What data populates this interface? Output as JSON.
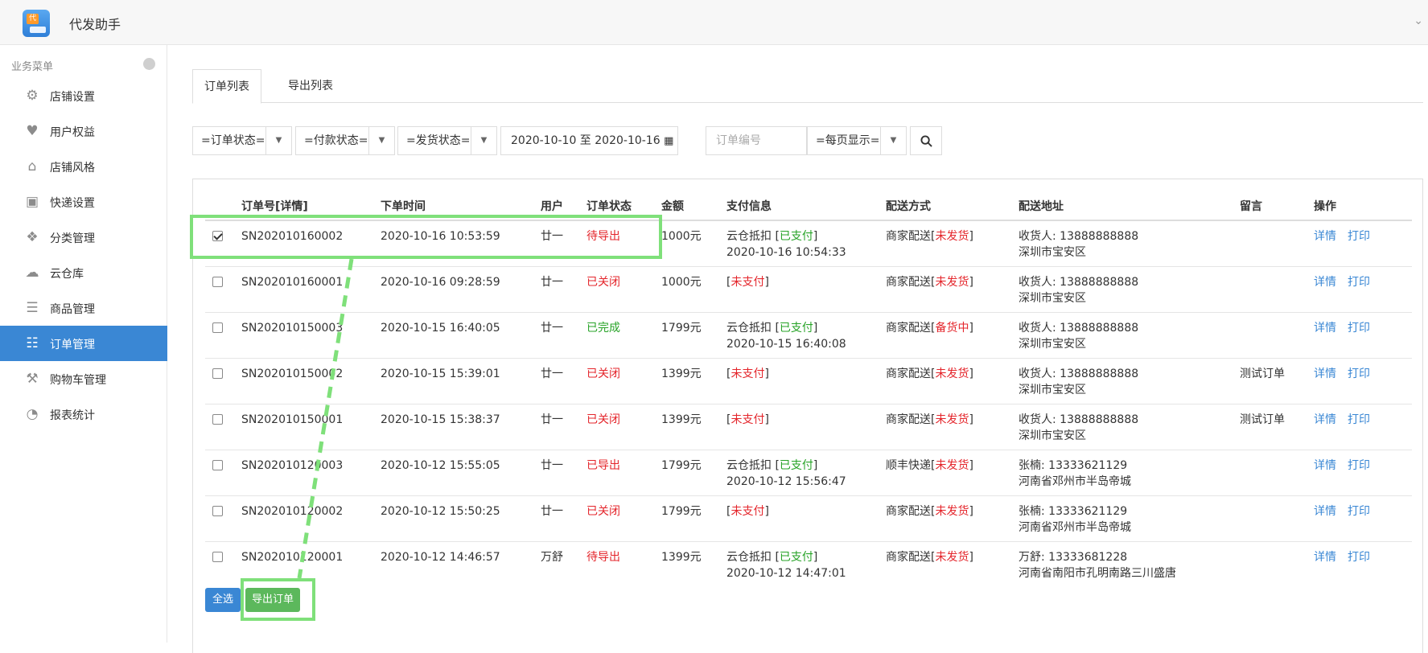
{
  "app": {
    "title": "代发助手",
    "logo_tag": "代"
  },
  "sidebar": {
    "header": "业务菜单",
    "items": [
      {
        "label": "店铺设置",
        "icon": "gear-icon"
      },
      {
        "label": "用户权益",
        "icon": "heart-icon"
      },
      {
        "label": "店铺风格",
        "icon": "home-icon"
      },
      {
        "label": "快递设置",
        "icon": "bag-icon"
      },
      {
        "label": "分类管理",
        "icon": "grid-icon"
      },
      {
        "label": "云仓库",
        "icon": "cloud-icon"
      },
      {
        "label": "商品管理",
        "icon": "list-icon"
      },
      {
        "label": "订单管理",
        "icon": "receipt-icon"
      },
      {
        "label": "购物车管理",
        "icon": "cart-icon"
      },
      {
        "label": "报表统计",
        "icon": "pie-chart-icon"
      }
    ],
    "active_index": 7
  },
  "tabs": [
    {
      "label": "订单列表"
    },
    {
      "label": "导出列表"
    }
  ],
  "filters": {
    "order_status": "=订单状态=",
    "pay_status": "=付款状态=",
    "ship_status": "=发货状态=",
    "date_range": "2020-10-10 至 2020-10-16",
    "order_no_placeholder": "订单编号",
    "per_page": "=每页显示="
  },
  "table": {
    "headers": [
      "订单号[详情]",
      "下单时间",
      "用户",
      "订单状态",
      "金额",
      "支付信息",
      "配送方式",
      "配送地址",
      "留言",
      "操作"
    ],
    "rows": [
      {
        "checked": true,
        "order_no": "SN202010160002",
        "time": "2020-10-16 10:53:59",
        "user": "廿一",
        "status": "待导出",
        "status_color": "red",
        "amount": "1000元",
        "pay_main": "云仓抵扣 [",
        "pay_tag": "已支付",
        "pay_tag_color": "green",
        "pay_end": "]",
        "pay_time": "2020-10-16 10:54:33",
        "ship_main": "商家配送[",
        "ship_tag": "未发货",
        "ship_end": "]",
        "addr1": "收货人: 13888888888",
        "addr2": "深圳市宝安区",
        "note": ""
      },
      {
        "checked": false,
        "order_no": "SN202010160001",
        "time": "2020-10-16 09:28:59",
        "user": "廿一",
        "status": "已关闭",
        "status_color": "red",
        "amount": "1000元",
        "pay_main": "[",
        "pay_tag": "未支付",
        "pay_tag_color": "red",
        "pay_end": "]",
        "pay_time": "",
        "ship_main": "商家配送[",
        "ship_tag": "未发货",
        "ship_end": "]",
        "addr1": "收货人: 13888888888",
        "addr2": "深圳市宝安区",
        "note": ""
      },
      {
        "checked": false,
        "order_no": "SN202010150003",
        "time": "2020-10-15 16:40:05",
        "user": "廿一",
        "status": "已完成",
        "status_color": "green",
        "amount": "1799元",
        "pay_main": "云仓抵扣 [",
        "pay_tag": "已支付",
        "pay_tag_color": "green",
        "pay_end": "]",
        "pay_time": "2020-10-15 16:40:08",
        "ship_main": "商家配送[",
        "ship_tag": "备货中",
        "ship_end": "]",
        "addr1": "收货人: 13888888888",
        "addr2": "深圳市宝安区",
        "note": ""
      },
      {
        "checked": false,
        "order_no": "SN202010150002",
        "time": "2020-10-15 15:39:01",
        "user": "廿一",
        "status": "已关闭",
        "status_color": "red",
        "amount": "1399元",
        "pay_main": "[",
        "pay_tag": "未支付",
        "pay_tag_color": "red",
        "pay_end": "]",
        "pay_time": "",
        "ship_main": "商家配送[",
        "ship_tag": "未发货",
        "ship_end": "]",
        "addr1": "收货人: 13888888888",
        "addr2": "深圳市宝安区",
        "note": "测试订单"
      },
      {
        "checked": false,
        "order_no": "SN202010150001",
        "time": "2020-10-15 15:38:37",
        "user": "廿一",
        "status": "已关闭",
        "status_color": "red",
        "amount": "1399元",
        "pay_main": "[",
        "pay_tag": "未支付",
        "pay_tag_color": "red",
        "pay_end": "]",
        "pay_time": "",
        "ship_main": "商家配送[",
        "ship_tag": "未发货",
        "ship_end": "]",
        "addr1": "收货人: 13888888888",
        "addr2": "深圳市宝安区",
        "note": "测试订单"
      },
      {
        "checked": false,
        "order_no": "SN202010120003",
        "time": "2020-10-12 15:55:05",
        "user": "廿一",
        "status": "已导出",
        "status_color": "red",
        "amount": "1799元",
        "pay_main": "云仓抵扣 [",
        "pay_tag": "已支付",
        "pay_tag_color": "green",
        "pay_end": "]",
        "pay_time": "2020-10-12 15:56:47",
        "ship_main": "顺丰快递[",
        "ship_tag": "未发货",
        "ship_end": "]",
        "addr1": "张楠: 13333621129",
        "addr2": "河南省邓州市半岛帝城",
        "note": ""
      },
      {
        "checked": false,
        "order_no": "SN202010120002",
        "time": "2020-10-12 15:50:25",
        "user": "廿一",
        "status": "已关闭",
        "status_color": "red",
        "amount": "1799元",
        "pay_main": "[",
        "pay_tag": "未支付",
        "pay_tag_color": "red",
        "pay_end": "]",
        "pay_time": "",
        "ship_main": "商家配送[",
        "ship_tag": "未发货",
        "ship_end": "]",
        "addr1": "张楠: 13333621129",
        "addr2": "河南省邓州市半岛帝城",
        "note": ""
      },
      {
        "checked": false,
        "order_no": "SN202010120001",
        "time": "2020-10-12 14:46:57",
        "user": "万舒",
        "status": "待导出",
        "status_color": "red",
        "amount": "1399元",
        "pay_main": "云仓抵扣 [",
        "pay_tag": "已支付",
        "pay_tag_color": "green",
        "pay_end": "]",
        "pay_time": "2020-10-12 14:47:01",
        "ship_main": "商家配送[",
        "ship_tag": "未发货",
        "ship_end": "]",
        "addr1": "万舒: 13333681228",
        "addr2": "河南省南阳市孔明南路三川盛唐",
        "note": ""
      }
    ],
    "action_detail": "详情",
    "action_print": "打印"
  },
  "footer": {
    "select_all": "全选",
    "export": "导出订单"
  },
  "colors": {
    "accent": "#3a87d4",
    "success": "#5cb85c",
    "danger": "#e4252b",
    "highlight": "#7fe07a"
  }
}
